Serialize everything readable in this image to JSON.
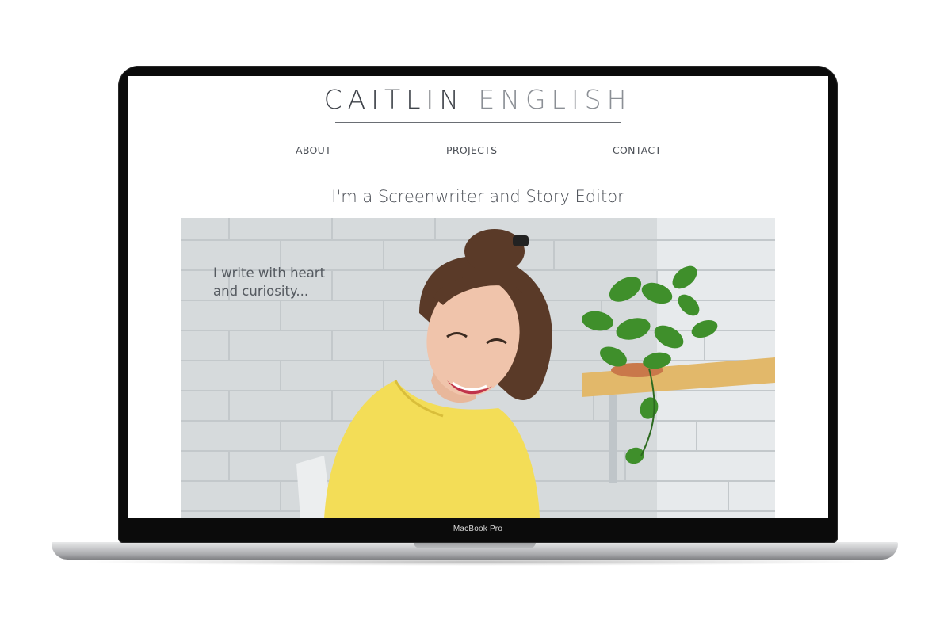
{
  "site": {
    "title_first": "CAITLIN",
    "title_last": "ENGLISH",
    "nav": {
      "about": "ABOUT",
      "projects": "PROJECTS",
      "contact": "CONTACT"
    },
    "tagline": "I'm a Screenwriter and Story Editor",
    "hero": {
      "quote_line1": "I write with heart",
      "quote_line2": "and curiosity..."
    }
  },
  "device": {
    "label": "MacBook Pro"
  },
  "colors": {
    "title_dark": "#3f434a",
    "title_light": "#8b8f95",
    "text": "#4a4e55",
    "shirt_yellow": "#f3dd57",
    "plant_green": "#3f8f2b"
  }
}
